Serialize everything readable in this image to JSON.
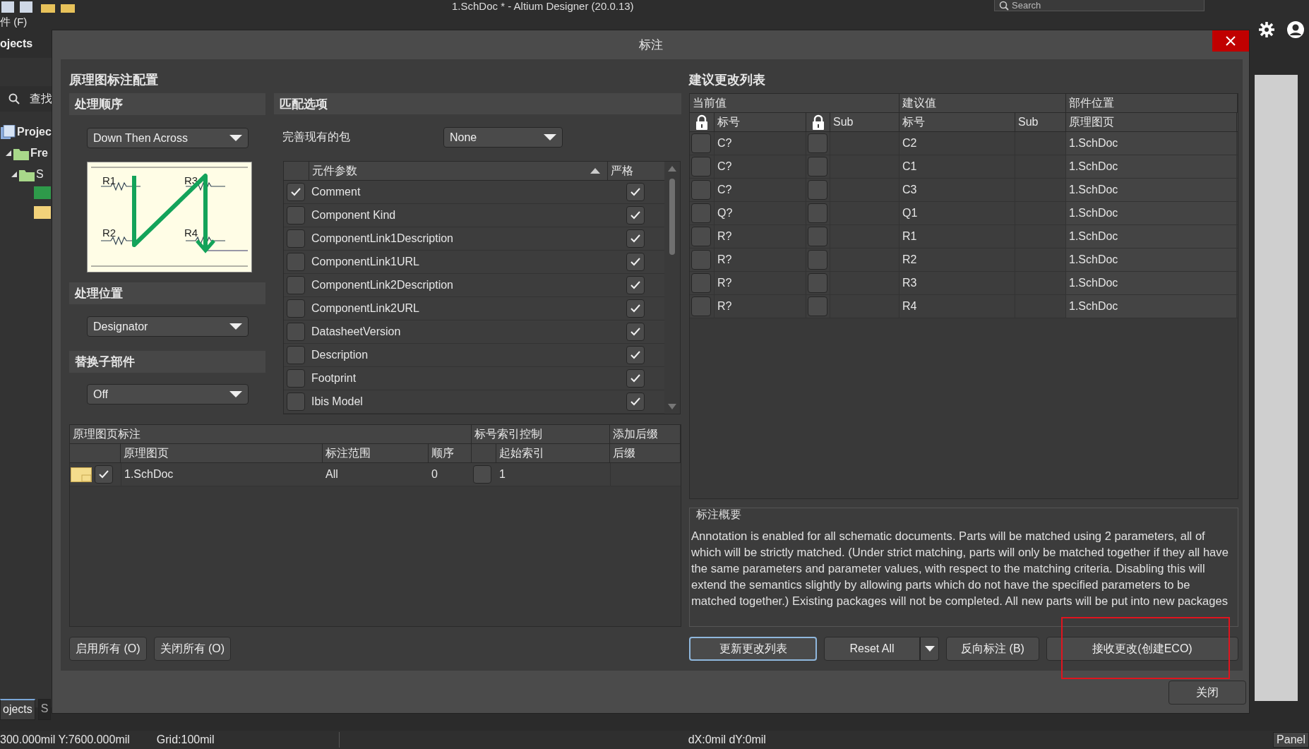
{
  "app": {
    "title": "1.SchDoc * - Altium Designer (20.0.13)",
    "search": {
      "placeholder": "Search"
    },
    "menu": [
      "件 (F)"
    ]
  },
  "left_panel": {
    "header": "ojects",
    "search_label": "查找",
    "tree": [
      {
        "label": "Projec",
        "children": [
          {
            "label": "Fre",
            "expanded": true,
            "children": [
              {
                "label": "S",
                "expanded": true
              }
            ]
          }
        ]
      }
    ],
    "tabs": [
      {
        "label": "ojects",
        "selected": true
      },
      {
        "label": "S",
        "selected": false
      }
    ]
  },
  "dialog": {
    "title": "标注",
    "config": {
      "heading": "原理图标注配置",
      "order": {
        "heading": "处理顺序",
        "value": "Down Then Across",
        "preview_labels": [
          "R1",
          "R3",
          "R2",
          "R4"
        ]
      },
      "location": {
        "heading": "处理位置",
        "value": "Designator"
      },
      "replace": {
        "heading": "替换子部件",
        "value": "Off"
      },
      "matching": {
        "heading": "匹配选项",
        "complete_label": "完善现有的包",
        "complete_value": "None",
        "columns": [
          "元件参数",
          "严格"
        ],
        "rows": [
          {
            "name": "Comment",
            "checked": true,
            "strict": true
          },
          {
            "name": "Component Kind",
            "checked": false,
            "strict": true
          },
          {
            "name": "ComponentLink1Description",
            "checked": false,
            "strict": true
          },
          {
            "name": "ComponentLink1URL",
            "checked": false,
            "strict": true
          },
          {
            "name": "ComponentLink2Description",
            "checked": false,
            "strict": true
          },
          {
            "name": "ComponentLink2URL",
            "checked": false,
            "strict": true
          },
          {
            "name": "DatasheetVersion",
            "checked": false,
            "strict": true
          },
          {
            "name": "Description",
            "checked": false,
            "strict": true
          },
          {
            "name": "Footprint",
            "checked": false,
            "strict": true
          },
          {
            "name": "Ibis Model",
            "checked": false,
            "strict": true
          }
        ]
      },
      "sheets": {
        "groups": [
          "原理图页标注",
          "标号索引控制",
          "添加后缀"
        ],
        "columns": [
          "原理图页",
          "标注范围",
          "顺序",
          "起始索引",
          "后缀"
        ],
        "rows": [
          {
            "enabled": true,
            "sheet": "1.SchDoc",
            "scope": "All",
            "order": "0",
            "use_start": false,
            "start": "1"
          }
        ]
      },
      "buttons": [
        "启用所有 (O)",
        "关闭所有 (O)"
      ]
    },
    "changes": {
      "heading": "建议更改列表",
      "groups": [
        "当前值",
        "建议值",
        "部件位置"
      ],
      "columns": [
        "标号",
        "Sub",
        "标号",
        "Sub",
        "原理图页"
      ],
      "rows": [
        {
          "current": "C?",
          "locked": false,
          "sub_locked": false,
          "proposed": "C2",
          "sheet": "1.SchDoc"
        },
        {
          "current": "C?",
          "locked": false,
          "sub_locked": false,
          "proposed": "C1",
          "sheet": "1.SchDoc"
        },
        {
          "current": "C?",
          "locked": false,
          "sub_locked": false,
          "proposed": "C3",
          "sheet": "1.SchDoc"
        },
        {
          "current": "Q?",
          "locked": false,
          "sub_locked": false,
          "proposed": "Q1",
          "sheet": "1.SchDoc"
        },
        {
          "current": "R?",
          "locked": false,
          "sub_locked": false,
          "proposed": "R1",
          "sheet": "1.SchDoc"
        },
        {
          "current": "R?",
          "locked": false,
          "sub_locked": false,
          "proposed": "R2",
          "sheet": "1.SchDoc"
        },
        {
          "current": "R?",
          "locked": false,
          "sub_locked": false,
          "proposed": "R3",
          "sheet": "1.SchDoc"
        },
        {
          "current": "R?",
          "locked": false,
          "sub_locked": false,
          "proposed": "R4",
          "sheet": "1.SchDoc"
        }
      ]
    },
    "summary": {
      "heading": "标注概要",
      "text": "Annotation is enabled for all schematic documents. Parts will be matched using 2 parameters, all of which will be strictly matched. (Under strict matching, parts will only be matched together if they all have the same parameters and parameter values, with respect to the matching criteria. Disabling this will extend the semantics slightly by allowing parts which do not have the specified parameters to be matched together.) Existing packages will not be completed. All new parts will be put into new packages"
    },
    "buttons": [
      {
        "label": "更新更改列表",
        "kind": "default",
        "highlighted": false
      },
      {
        "label": "Reset All",
        "kind": "split",
        "highlighted": false
      },
      {
        "label": "反向标注 (B)",
        "kind": "plain",
        "highlighted": false
      },
      {
        "label": "接收更改(创建ECO)",
        "kind": "plain",
        "highlighted": true
      }
    ],
    "close": "关闭"
  },
  "status_bar": {
    "position": "300.000mil Y:7600.000mil",
    "grid": "Grid:100mil",
    "delta": "dX:0mil dY:0mil",
    "panels": "Panel"
  }
}
